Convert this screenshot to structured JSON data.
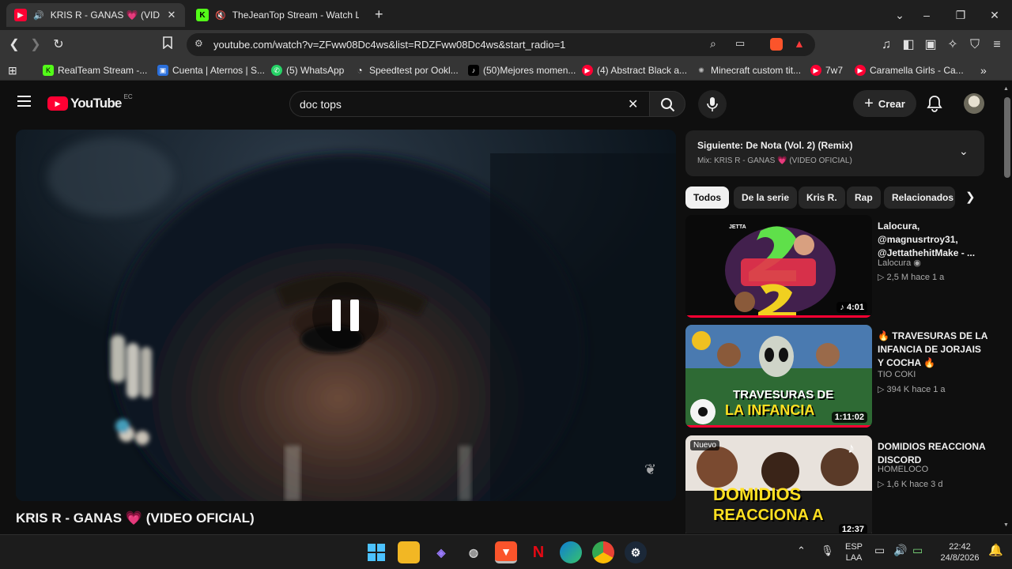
{
  "browser": {
    "tabs": [
      {
        "title": "KRIS R - GANAS 💗 (VIDEO OFICIAL)",
        "active": true
      },
      {
        "title": "TheJeanTop Stream - Watch Live on Kick",
        "active": false
      }
    ],
    "new_tab_label": "+",
    "url": "youtube.com/watch?v=ZFww08Dc4ws&list=RDZFww08Dc4ws&start_radio=1",
    "bookmarks": [
      {
        "label": "RealTeam Stream -..."
      },
      {
        "label": "Cuenta | Aternos | S..."
      },
      {
        "label": "(5) WhatsApp"
      },
      {
        "label": "Speedtest por Ookl..."
      },
      {
        "label": "(50)Mejores momen..."
      },
      {
        "label": "(4) Abstract Black a..."
      },
      {
        "label": "Minecraft custom tit..."
      },
      {
        "label": "7w7"
      },
      {
        "label": "Caramella Girls - Ca..."
      }
    ]
  },
  "youtube": {
    "logo_text": "YouTube",
    "country": "EC",
    "search_value": "doc tops",
    "create_label": "Crear",
    "video_title": "KRIS R - GANAS 💗 (VIDEO OFICIAL)",
    "next": {
      "title": "Siguiente: De Nota (Vol. 2) (Remix)",
      "subtitle": "Mix: KRIS R - GANAS 💗 (VIDEO OFICIAL)"
    },
    "chips": [
      "Todos",
      "De la serie",
      "Kris R.",
      "Rap",
      "Relacionados"
    ],
    "recommendations": [
      {
        "title": "Lalocura, @magnusrtroy31, @JettathehitMake - ...",
        "channel": "Lalocura",
        "views": "2,5 M",
        "age": "hace 1 a",
        "duration": "4:01",
        "thumb_text": "JETTA"
      },
      {
        "title": "🔥 TRAVESURAS DE LA INFANCIA DE JORJAIS Y COCHA 🔥",
        "channel": "TIO COKI",
        "views": "394 K",
        "age": "hace 1 a",
        "duration": "1:11:02",
        "thumb_line1": "TRAVESURAS DE",
        "thumb_line2": "LA INFANCIA"
      },
      {
        "title": "DOMIDIOS REACCIONA DISCORD",
        "channel": "HOMELOCO",
        "views": "1,6 K",
        "age": "hace 3 d",
        "duration": "12:37",
        "badge": "Nuevo",
        "thumb_line1": "DOMIDIOS",
        "thumb_line2": "REACCIONA A"
      }
    ]
  },
  "taskbar": {
    "lang": "ESP",
    "layout": "LAA",
    "time": "22:42",
    "date": "24/8/2026"
  },
  "colors": {
    "yt_red": "#ff0033",
    "yt_bg": "#0f0f0f",
    "chrome_dark": "#1f1f1f",
    "chrome_mid": "#353535"
  }
}
